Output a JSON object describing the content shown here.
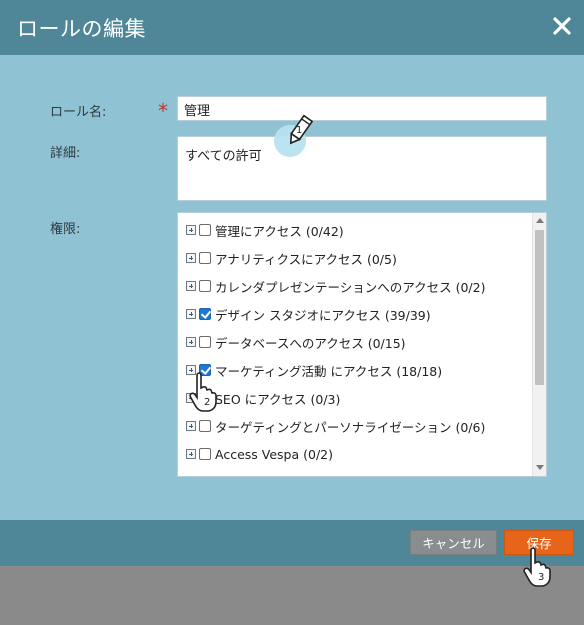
{
  "dialog": {
    "title": "ロールの編集",
    "close_icon": "close-icon"
  },
  "form": {
    "role_name_label": "ロール名:",
    "role_name_value": "管理",
    "required_mark": "*",
    "description_label": "詳細:",
    "description_value": "すべての許可",
    "permissions_label": "権限:"
  },
  "permissions": [
    {
      "label": "管理にアクセス (0/42)",
      "checked": false
    },
    {
      "label": "アナリティクスにアクセス (0/5)",
      "checked": false
    },
    {
      "label": "カレンダプレゼンテーションへのアクセス (0/2)",
      "checked": false
    },
    {
      "label": "デザイン スタジオにアクセス (39/39)",
      "checked": true
    },
    {
      "label": "データベースへのアクセス (0/15)",
      "checked": false
    },
    {
      "label": "マーケティング活動 にアクセス (18/18)",
      "checked": true
    },
    {
      "label": "SEO にアクセス (0/3)",
      "checked": false
    },
    {
      "label": "ターゲティングとパーソナライゼーション (0/6)",
      "checked": false
    },
    {
      "label": "Access Vespa (0/2)",
      "checked": false
    }
  ],
  "footer": {
    "cancel_label": "キャンセル",
    "save_label": "保存"
  },
  "annotations": {
    "step1": "1",
    "step2": "2",
    "step3": "3"
  },
  "colors": {
    "header": "#4f8799",
    "body": "#8fc3d4",
    "save": "#e7651b",
    "cancel": "#8a8d8f",
    "checkbox_checked": "#1f78d1",
    "required": "#c0392b"
  }
}
